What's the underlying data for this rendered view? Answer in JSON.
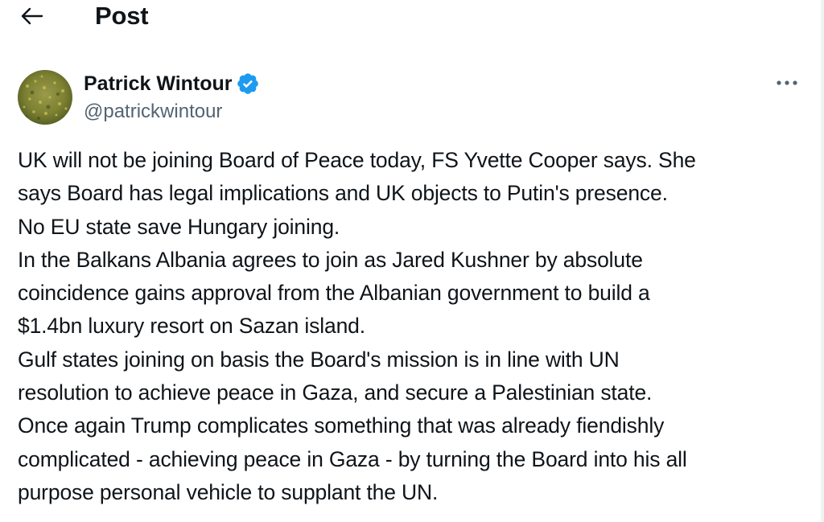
{
  "header": {
    "title": "Post"
  },
  "author": {
    "name": "Patrick Wintour",
    "handle": "@patrickwintour",
    "verified": true
  },
  "post": {
    "lines": [
      "UK will not be joining Board of Peace today, FS Yvette Cooper says.  She",
      "says Board has legal implications and UK objects to Putin's presence.",
      "No EU state save Hungary joining.",
      "In the Balkans Albania agrees to join as Jared Kushner by absolute",
      "coincidence gains approval from the Albanian government to build a",
      "$1.4bn luxury resort on Sazan island.",
      "Gulf states joining on basis the Board's mission is in line with UN",
      "resolution to achieve peace in Gaza, and secure a Palestinian state.",
      "Once again Trump complicates something that was already fiendishly",
      "complicated - achieving peace in Gaza - by turning the Board into his all",
      "purpose personal vehicle to supplant the UN."
    ]
  },
  "icons": {
    "back": "back-arrow-icon",
    "verified": "verified-badge-icon",
    "more": "more-options-icon"
  },
  "colors": {
    "text": "#0f1419",
    "secondary_text": "#536471",
    "verified_blue": "#1d9bf0",
    "background": "#ffffff"
  }
}
